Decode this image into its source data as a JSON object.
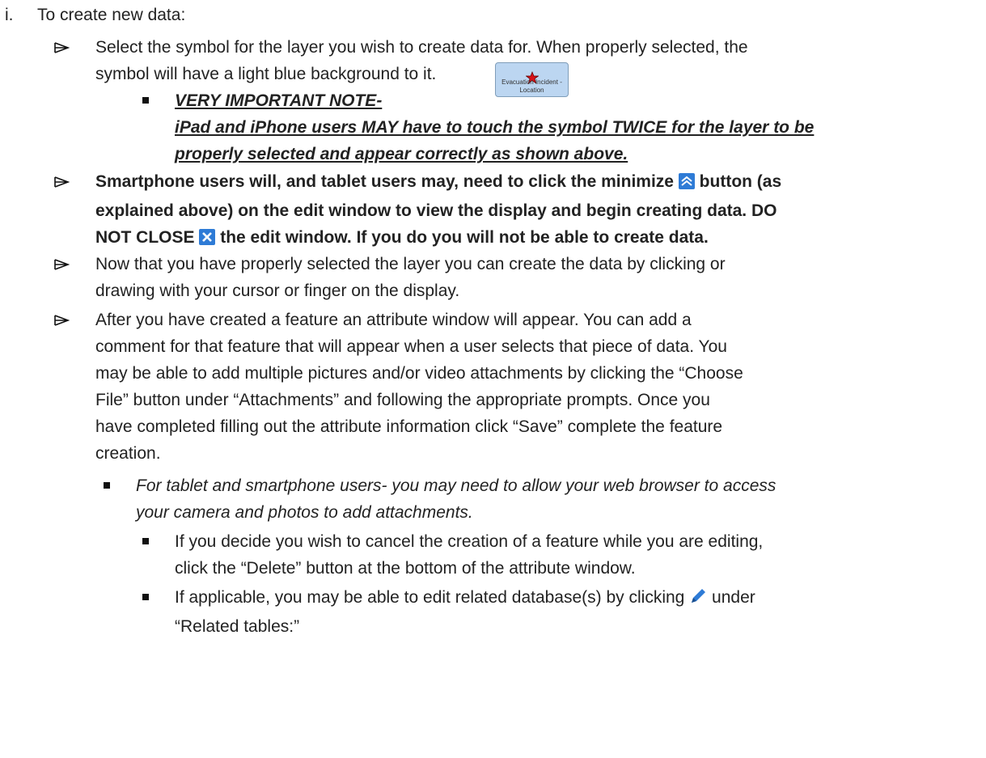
{
  "list_marker": "i.",
  "heading": "To create new data:",
  "item1": {
    "text": "Select the symbol for the layer you wish to create data for.  When properly selected, the",
    "text2": "symbol will have a light blue background to it.",
    "symbol_label": "Evacuation Incident - Location",
    "note_title": "VERY IMPORTANT NOTE-",
    "note_line1": "iPad and iPhone users MAY have to touch the symbol TWICE for the layer to be",
    "note_line2": "properly selected and appear correctly as shown above."
  },
  "item2": {
    "line1a": "Smartphone users will, and tablet users may, need to click the minimize",
    "line1b": "button (as",
    "line2": "explained above) on the edit window to view the display and begin creating data.  DO",
    "line3a": "NOT CLOSE",
    "line3b": "the edit window.  If you do you will not be able to create data."
  },
  "item3": {
    "line1": "Now that you have properly selected the layer you can create the data by clicking or",
    "line2": "drawing with your cursor or finger on the display."
  },
  "item4": {
    "line1": "After you have created a feature an attribute window will appear.  You can add a",
    "line2": "comment for that feature that will appear when a user selects that piece of data.  You",
    "line3": "may be able to add multiple pictures and/or video attachments by clicking the “Choose",
    "line4": "File” button under “Attachments” and following the appropriate prompts.  Once you",
    "line5": "have completed filling out the attribute information click “Save” complete the feature",
    "line6": "creation."
  },
  "item5": {
    "line1": "For tablet and smartphone users- you may need to allow your web browser to access",
    "line2": "your camera and photos to add attachments."
  },
  "item6": {
    "line1": "If you decide you wish to cancel the creation of a feature while you are editing,",
    "line2": "click the “Delete” button at the bottom of the attribute window."
  },
  "item7": {
    "line1a": "If applicable, you may be able to edit related database(s) by clicking",
    "line1b": "under",
    "line2": "“Related tables:”"
  },
  "icons": {
    "star": "red-star-icon",
    "minimize": "minimize-icon",
    "close": "close-icon",
    "pencil": "pencil-icon"
  },
  "colors": {
    "symbol_bg": "#bcd6f1",
    "icon_blue": "#2e7bd6",
    "star_red": "#d8131a"
  }
}
